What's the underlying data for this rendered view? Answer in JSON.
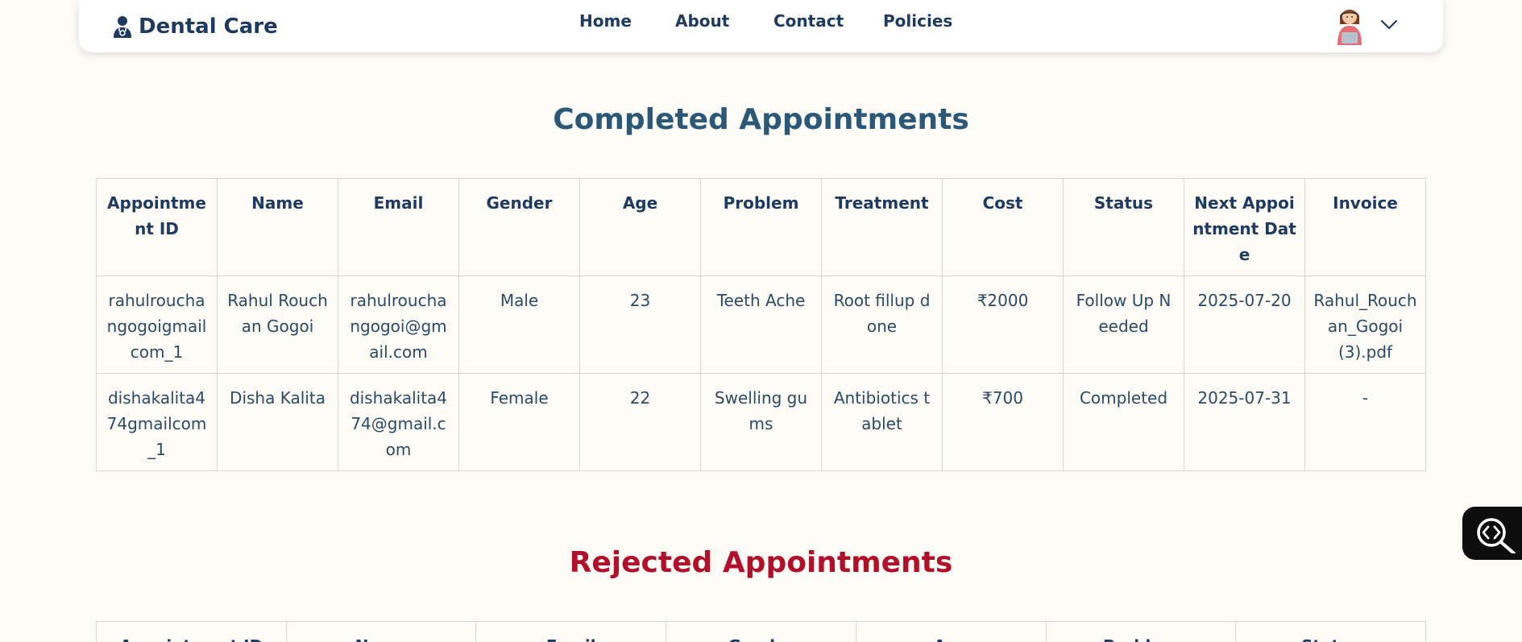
{
  "nav": {
    "brand": "Dental Care",
    "links": [
      "Home",
      "About",
      "Contact",
      "Policies"
    ]
  },
  "completed": {
    "title": "Completed Appointments",
    "headers": [
      "Appointment ID",
      "Name",
      "Email",
      "Gender",
      "Age",
      "Problem",
      "Treatment",
      "Cost",
      "Status",
      "Next Appointment Date",
      "Invoice"
    ],
    "rows": [
      [
        "rahulrouchangogoigmailcom_1",
        "Rahul Rouchan Gogoi",
        "rahulrouchangogoi@gmail.com",
        "Male",
        "23",
        "Teeth Ache",
        "Root fillup done",
        "₹2000",
        "Follow Up Needed",
        "2025-07-20",
        "Rahul_Rouchan_Gogoi (3).pdf"
      ],
      [
        "dishakalita474gmailcom_1",
        "Disha Kalita",
        "dishakalita474@gmail.com",
        "Female",
        "22",
        "Swelling gums",
        "Antibiotics tablet",
        "₹700",
        "Completed",
        "2025-07-31",
        "-"
      ]
    ]
  },
  "rejected": {
    "title": "Rejected Appointments",
    "headers": [
      "Appointment ID",
      "Name",
      "Email",
      "Gender",
      "Age",
      "Problem",
      "Status"
    ]
  },
  "colors": {
    "background": "#fdfbf5",
    "primary": "#1e3a5f",
    "completed_title": "#2b5876",
    "rejected_title": "#b0102a"
  }
}
